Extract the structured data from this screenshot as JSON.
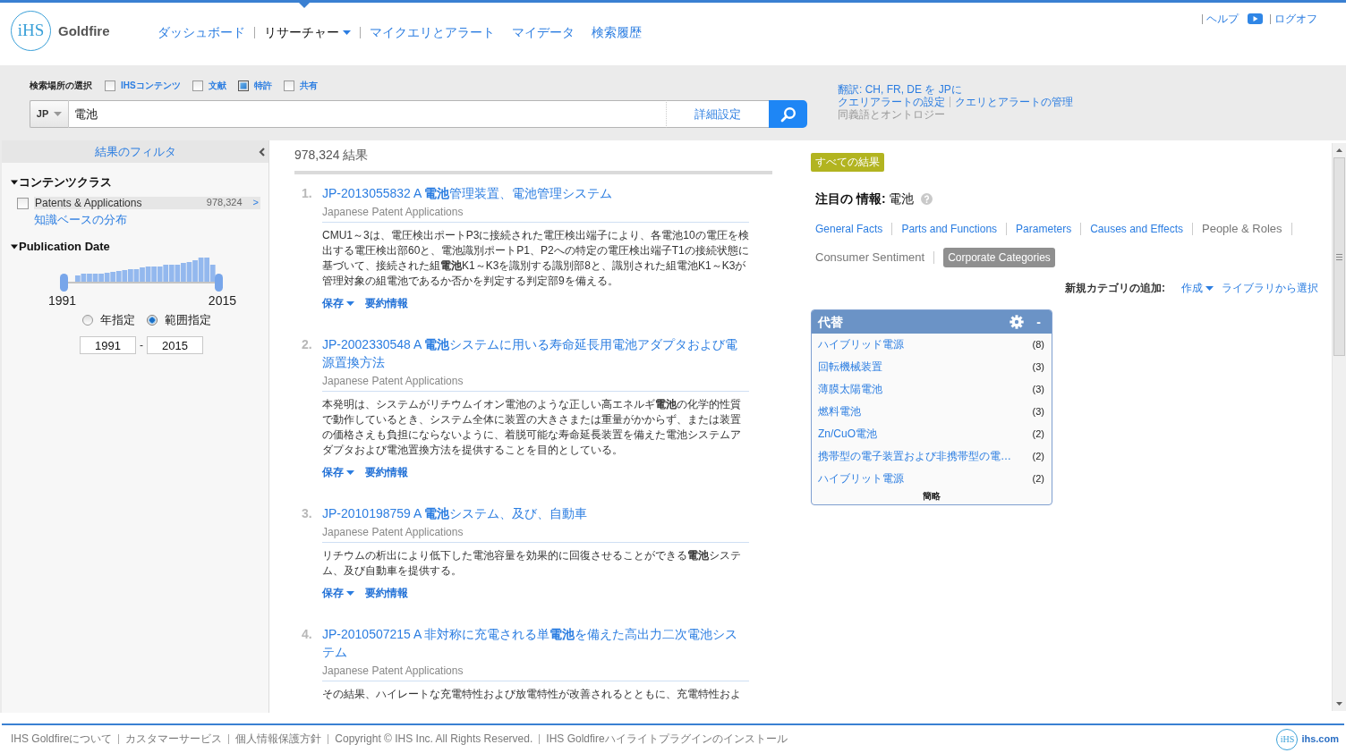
{
  "header": {
    "logo": {
      "mark": "iHS",
      "name": "Goldfire"
    },
    "nav_groups": [
      [
        {
          "label": "ダッシュボード",
          "selected": false,
          "dropdown": false
        }
      ],
      [
        {
          "label": "リサーチャー",
          "selected": true,
          "dropdown": true
        }
      ],
      [
        {
          "label": "マイクエリとアラート",
          "selected": false,
          "dropdown": false
        },
        {
          "label": "マイデータ",
          "selected": false,
          "dropdown": false
        },
        {
          "label": "検索履歴",
          "selected": false,
          "dropdown": false
        }
      ]
    ],
    "utility_groups": [
      [
        {
          "kind": "link",
          "label": "ヘルプ"
        },
        {
          "kind": "video"
        }
      ],
      [
        {
          "kind": "link",
          "label": "ログオフ"
        }
      ]
    ]
  },
  "search": {
    "scope_label": "検索場所の選択",
    "scopes": [
      {
        "label": "IHSコンテンツ",
        "checked": false
      },
      {
        "label": "文献",
        "checked": false
      },
      {
        "label": "特許",
        "checked": true
      },
      {
        "label": "共有",
        "checked": false
      }
    ],
    "language": "JP",
    "query": "電池",
    "advanced": "詳細設定"
  },
  "search_links": [
    [
      {
        "label": "翻訳: CH, FR, DE を JPに",
        "disabled": false
      }
    ],
    [
      {
        "label": "クエリアラートの設定",
        "disabled": false
      },
      {
        "label": "クエリとアラートの管理",
        "disabled": false
      }
    ],
    [
      {
        "label": "同義語とオントロジー",
        "disabled": true
      }
    ]
  ],
  "filters": {
    "title": "結果のフィルタ",
    "sections": [
      {
        "kind": "checklist",
        "title": "コンテンツクラス",
        "expanded": true,
        "options": [
          {
            "label": "Patents & Applications",
            "count": "978,324",
            "more": ">",
            "checked": false
          }
        ],
        "link": "知識ベースの分布"
      },
      {
        "kind": "daterange",
        "title": "Publication Date",
        "expanded": true,
        "thumbs": [
          {
            "level": 0
          },
          {
            "level": 1
          }
        ],
        "min_label": "1991",
        "max_label": "2015",
        "modes": [
          {
            "label": "年指定",
            "selected": false
          },
          {
            "label": "範囲指定",
            "selected": true
          }
        ],
        "from": "1991",
        "separator": "-",
        "to": "2015"
      }
    ]
  },
  "results": {
    "count": "978,324 結果",
    "items": [
      {
        "number": "1.",
        "title": "JP-2013055832 A **電池**管理装置、電池管理システム",
        "source": "Japanese Patent Applications",
        "snippet": "CMU1～3は、電圧検出ポートP3に接続された電圧検出端子により、各電池10の電圧を検出する電圧検出部60と、電池識別ポートP1、P2への特定の電圧検出端子T1の接続状態に基づいて、接続された組**電池**K1～K3を識別する識別部8と、識別された組電池K1～K3が管理対象の組電池であるか否かを判定する判定部9を備える。",
        "actions": [
          {
            "label": "保存",
            "dropdown": true
          },
          {
            "label": "要約情報",
            "dropdown": false
          }
        ]
      },
      {
        "number": "2.",
        "title": "JP-2002330548 A **電池**システムに用いる寿命延長用電池アダプタおよび電源置換方法",
        "source": "Japanese Patent Applications",
        "snippet": "本発明は、システムがリチウムイオン電池のような正しい高エネルギ**電池**の化学的性質で動作しているとき、システム全体に装置の大きさまたは重量がかからず、または装置の価格さえも負担にならないように、着脱可能な寿命延長装置を備えた電池システムアダプタおよび電池置換方法を提供することを目的としている。",
        "actions": [
          {
            "label": "保存",
            "dropdown": true
          },
          {
            "label": "要約情報",
            "dropdown": false
          }
        ]
      },
      {
        "number": "3.",
        "title": "JP-2010198759 A **電池**システム、及び、自動車",
        "source": "Japanese Patent Applications",
        "snippet": "リチウムの析出により低下した電池容量を効果的に回復させることができる**電池**システム、及び自動車を提供する。",
        "actions": [
          {
            "label": "保存",
            "dropdown": true
          },
          {
            "label": "要約情報",
            "dropdown": false
          }
        ]
      },
      {
        "number": "4.",
        "title": "JP-2010507215 A 非対称に充電される単**電池**を備えた高出力二次電池システム",
        "source": "Japanese Patent Applications",
        "snippet": "その結果、ハイレートな充電特性および放電特性が改善されるとともに、充電特性およ"
      }
    ]
  },
  "insights": {
    "scope_tag": "すべての結果",
    "focus": "**注目の 情報:** 電池",
    "categories": [
      {
        "label": "General Facts",
        "selected": false,
        "disabled": false
      },
      {
        "label": "Parts and Functions",
        "selected": false,
        "disabled": false
      },
      {
        "label": "Parameters",
        "selected": false,
        "disabled": false
      },
      {
        "label": "Causes and Effects",
        "selected": false,
        "disabled": false
      },
      {
        "label": "People & Roles",
        "selected": false,
        "disabled": true
      },
      {
        "label": "Consumer Sentiment",
        "selected": false,
        "disabled": true
      },
      {
        "label": "Corporate Categories",
        "selected": true,
        "disabled": false
      }
    ],
    "new_category": {
      "label": "新規カテゴリの追加:",
      "actions": [
        {
          "label": "作成",
          "dropdown": true
        },
        {
          "label": "ライブラリから選択",
          "dropdown": false
        }
      ]
    },
    "panel": {
      "title": "代替",
      "collapse": "-",
      "items": [
        {
          "label": "ハイブリッド電源",
          "count": "(8)"
        },
        {
          "label": "回転機械装置",
          "count": "(3)"
        },
        {
          "label": "薄膜太陽電池",
          "count": "(3)"
        },
        {
          "label": "燃料電池",
          "count": "(3)"
        },
        {
          "label": "Zn/CuO電池",
          "count": "(2)"
        },
        {
          "label": "携帯型の電子装置および非携帯型の電…",
          "count": "(2)"
        },
        {
          "label": "ハイブリット電源",
          "count": "(2)"
        }
      ],
      "footer": "簡略"
    }
  },
  "footer": {
    "links": [
      "IHS Goldfireについて",
      "カスタマーサービス",
      "個人情報保護方針",
      "Copyright © IHS Inc. All Rights Reserved.",
      "IHS Goldfireハイライトプラグインのインストール"
    ],
    "logo": {
      "mark": "iHS",
      "site": "ihs.com"
    }
  }
}
